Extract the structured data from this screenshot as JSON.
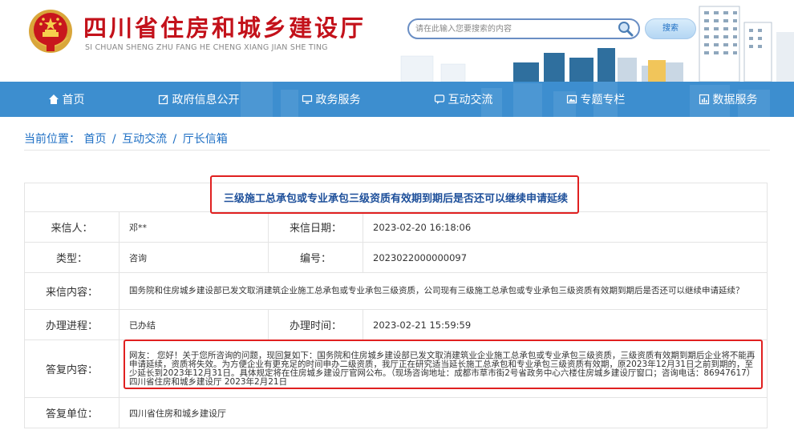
{
  "site": {
    "title": "四川省住房和城乡建设厅",
    "subtitle": "SI CHUAN SHENG ZHU FANG HE CHENG XIANG JIAN SHE TING"
  },
  "search": {
    "placeholder": "请在此输入您要搜索的内容",
    "button_label": "搜索"
  },
  "nav": {
    "items": [
      {
        "label": "首页",
        "icon": "home-icon"
      },
      {
        "label": "政府信息公开",
        "icon": "edit-icon"
      },
      {
        "label": "政务服务",
        "icon": "monitor-icon"
      },
      {
        "label": "互动交流",
        "icon": "chat-icon"
      },
      {
        "label": "专题专栏",
        "icon": "image-icon"
      },
      {
        "label": "数据服务",
        "icon": "chart-icon"
      }
    ]
  },
  "breadcrumb": {
    "prefix": "当前位置：",
    "items": [
      "首页",
      "互动交流",
      "厅长信箱"
    ],
    "separator": "/"
  },
  "letter": {
    "title": "三级施工总承包或专业承包三级资质有效期到期后是否还可以继续申请延续",
    "sender_label": "来信人：",
    "sender": "邓**",
    "date_label": "来信日期：",
    "date": "2023-02-20 16:18:06",
    "type_label": "类型：",
    "type": "咨询",
    "number_label": "编号：",
    "number": "2023022000000097",
    "content_label": "来信内容：",
    "content": "国务院和住房城乡建设部已发文取消建筑企业施工总承包或专业承包三级资质，公司现有三级施工总承包或专业承包三级资质有效期到期后是否还可以继续申请延续？",
    "progress_label": "办理进程：",
    "progress": "已办结",
    "handle_time_label": "办理时间：",
    "handle_time": "2023-02-21 15:59:59",
    "reply_label": "答复内容：",
    "reply": "网友： 您好！关于您所咨询的问题，现回复如下：国务院和住房城乡建设部已发文取消建筑业企业施工总承包或专业承包三级资质，三级资质有效期到期后企业将不能再申请延续，资质将失效。为方便企业有更充足的时间申办二级资质，我厅正在研究适当延长施工总承包和专业承包三级资质有效期，原2023年12月31日之前到期的，至少延长到2023年12月31日。具体规定将在住房城乡建设厅官网公布。（现场咨询地址：成都市草市街2号省政务中心六楼住房城乡建设厅窗口；咨询电话：86947617）四川省住房和城乡建设厅 2023年2月21日",
    "reply_unit_label": "答复单位：",
    "reply_unit": "四川省住房和城乡建设厅"
  },
  "colors": {
    "brand_red": "#c3111a",
    "nav_blue": "#3d8ecf",
    "link_blue": "#1e6fc4",
    "highlight_red": "#e02020"
  }
}
